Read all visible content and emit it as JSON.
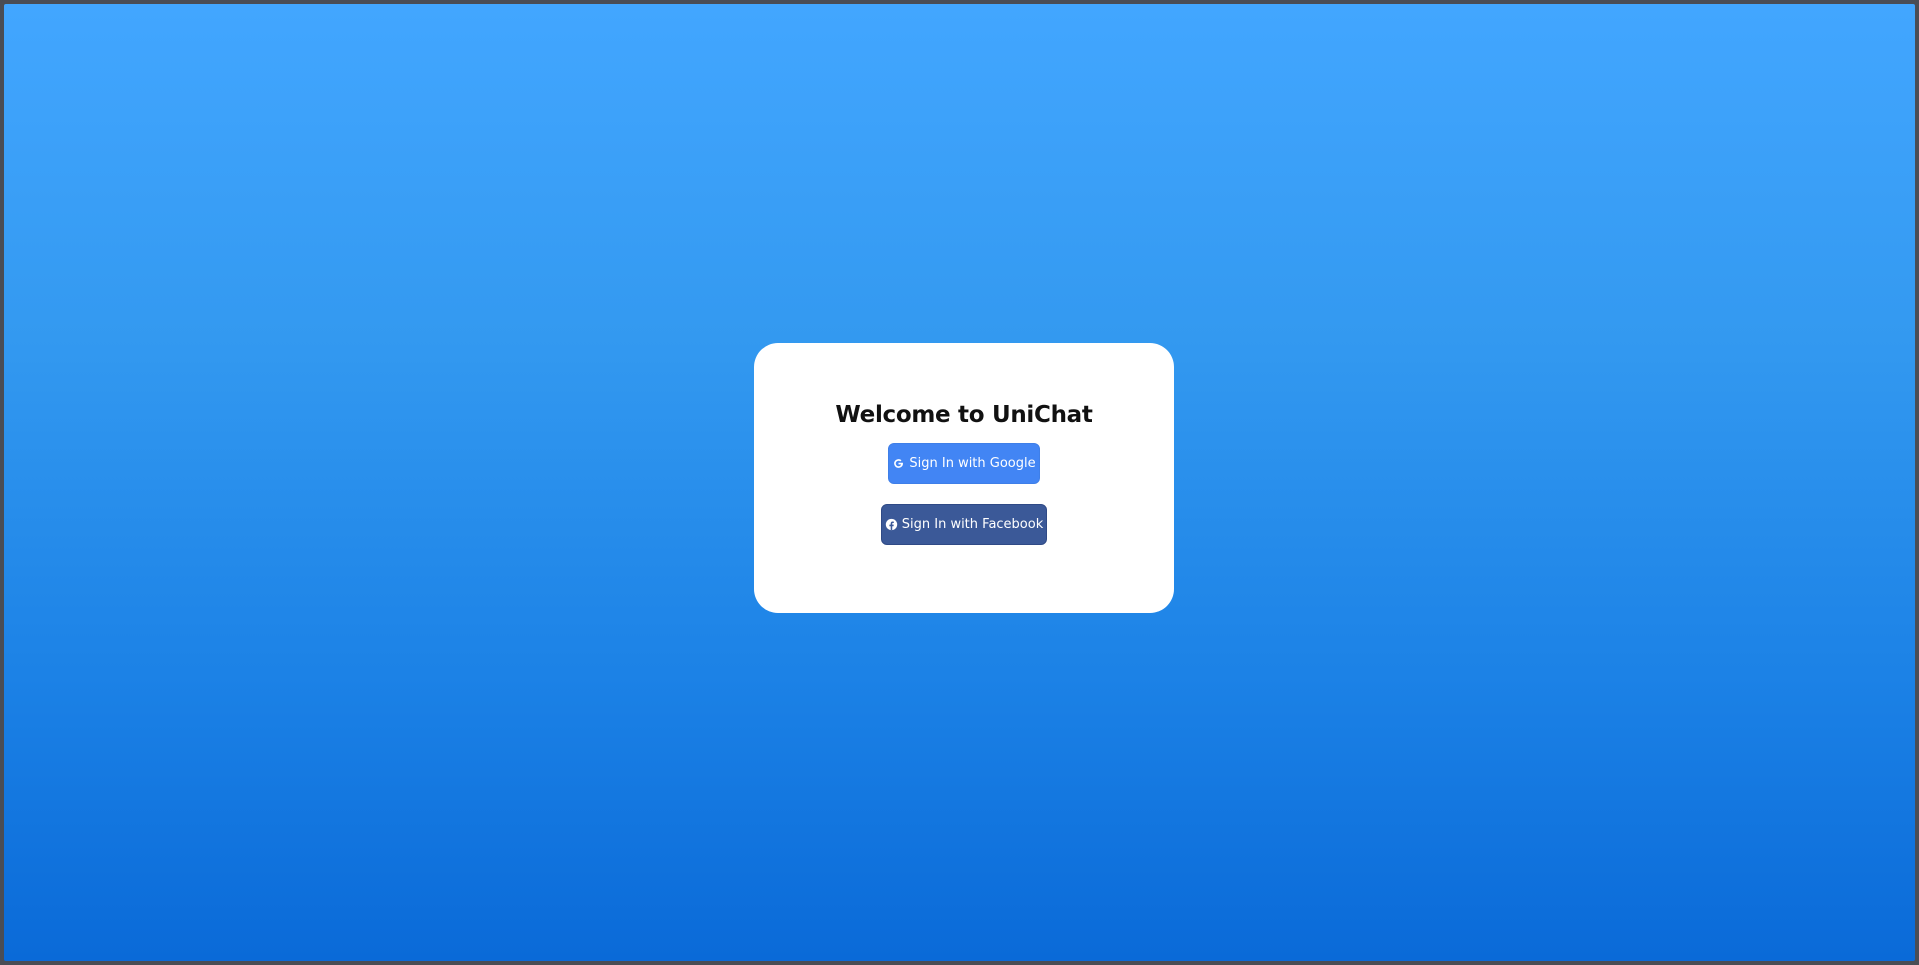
{
  "login": {
    "title": "Welcome to UniChat",
    "google_button": {
      "label": "Sign In with Google",
      "icon": "google-icon"
    },
    "facebook_button": {
      "label": "Sign In with Facebook",
      "icon": "facebook-icon"
    }
  },
  "colors": {
    "background_top": "#42a6ff",
    "background_bottom": "#0a6ad8",
    "card": "#ffffff",
    "google": "#4285f4",
    "facebook": "#3b5998"
  }
}
